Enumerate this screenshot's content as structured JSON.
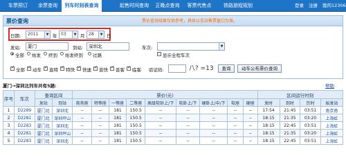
{
  "nav": {
    "items": [
      "车票预订",
      "余票查询",
      "列车时刻表查询",
      "起售时间查询",
      "正晚点查询",
      "客票代售点",
      "铁路旅程规划"
    ],
    "login": "登录",
    "register": "注册",
    "hotline": "我的12306"
  },
  "panel": {
    "title": "票价查询",
    "notice": "票价查询结果仅供参考，具体以车站售票窗口为准。"
  },
  "form": {
    "date_label": "日期:",
    "year": "2011",
    "year_unit": "年",
    "month": "03",
    "month_unit": "月",
    "day": "28",
    "day_unit": "日",
    "from_label": "发站:",
    "from_value": "厦门",
    "to_label": "到站:",
    "to_value": "深圳北",
    "train_label": "车次:",
    "train_value": "",
    "radios": [
      "全部",
      "始发",
      "终到",
      "始发终到",
      "过路"
    ],
    "show_full": "显示全程车次",
    "checks": [
      "全部",
      "动车",
      "直特",
      "特快",
      "快速",
      "普快",
      "普客",
      "临客"
    ],
    "captcha_label": "验证码:",
    "captcha_value": "",
    "captcha_img": "八? =13",
    "query_button": "查询",
    "notice_button": "动车公布票价查询"
  },
  "route": "厦门→深圳北列车共有5趟:",
  "help": "帮助",
  "table": {
    "group_headers": [
      "序号",
      "车次",
      "查询区间",
      "票价(元)",
      "区间运行时刻"
    ],
    "sub_headers": [
      "发站",
      "到站",
      "商务座",
      "特等座",
      "一等座",
      "二等座",
      "高级软卧上/下",
      "软卧上/下",
      "硬卧上/中/下",
      "软座",
      "硬座",
      "发时",
      "到时",
      "历时",
      "始发站"
    ],
    "rows": [
      [
        "1",
        "D2289",
        "厦门北",
        "深圳北",
        "--",
        "--",
        "181",
        "150.5",
        "--",
        "--",
        "--",
        "--",
        "--",
        "17:54",
        "21:45",
        "03:51",
        "南京南"
      ],
      [
        "2",
        "D2281",
        "厦门北",
        "深圳坪山",
        "--",
        "--",
        "181",
        "150.5",
        "--",
        "--",
        "--",
        "--",
        "--",
        "18:15",
        "21:35",
        "03:20",
        "上海虹"
      ],
      [
        "3",
        "D2283",
        "厦门北",
        "深圳北",
        "--",
        "--",
        "181",
        "150.5",
        "--",
        "--",
        "--",
        "--",
        "--",
        "18:15",
        "22:45",
        "03:51",
        "上海虹"
      ],
      [
        "4",
        "D2281",
        "厦门北",
        "深圳坪山",
        "--",
        "--",
        "181",
        "150.5",
        "--",
        "--",
        "--",
        "--",
        "--",
        "18:15",
        "21:35",
        "03:20",
        "上海虹"
      ],
      [
        "5",
        "D2283",
        "厦门北",
        "深圳北",
        "--",
        "--",
        "181",
        "150.5",
        "--",
        "--",
        "--",
        "--",
        "--",
        "18:15",
        "22:45",
        "03:51",
        "上海虹"
      ]
    ]
  }
}
